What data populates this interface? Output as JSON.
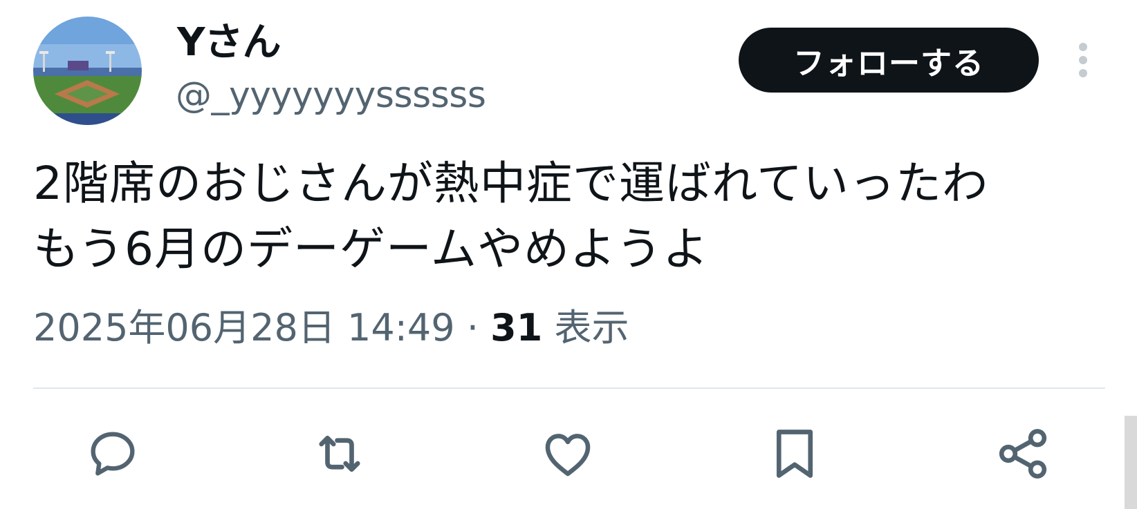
{
  "user": {
    "display_name": "Yさん",
    "handle": "@_yyyyyyyssssss"
  },
  "follow_button_label": "フォローする",
  "tweet": {
    "lines": [
      "2階席のおじさんが熱中症で運ばれていったわ",
      "もう6月のデーゲームやめようよ"
    ]
  },
  "meta": {
    "datetime": "2025年06月28日 14:49",
    "separator": "·",
    "view_count": "31",
    "view_label": "表示"
  },
  "actions": [
    {
      "icon": "reply-icon"
    },
    {
      "icon": "retweet-icon"
    },
    {
      "icon": "like-icon"
    },
    {
      "icon": "bookmark-icon"
    },
    {
      "icon": "share-icon"
    }
  ],
  "colors": {
    "text_primary": "#0f1419",
    "text_secondary": "#536471",
    "button_bg": "#0f1419",
    "button_text": "#ffffff",
    "divider": "#e1e6ea"
  }
}
